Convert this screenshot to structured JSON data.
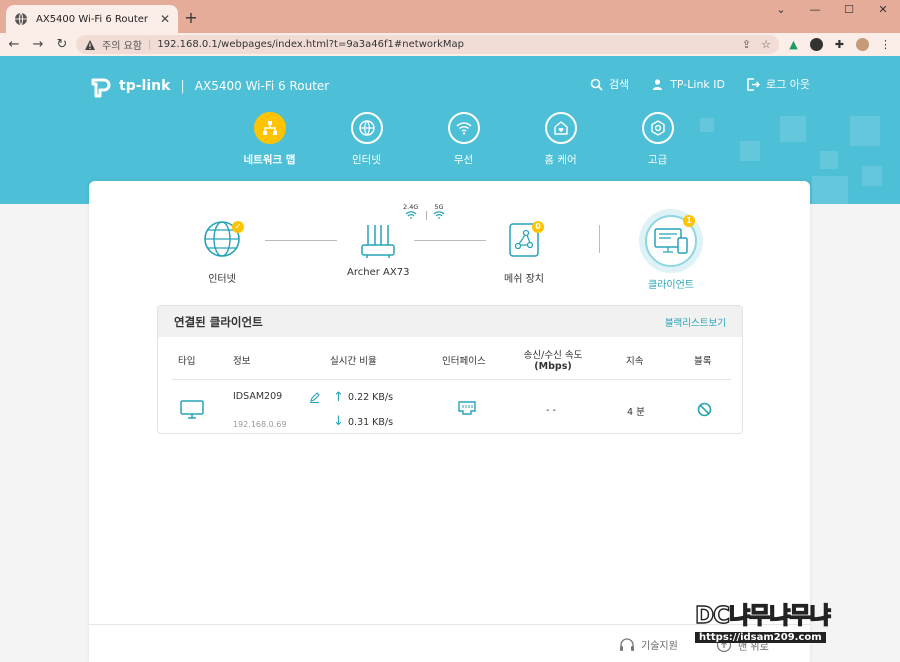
{
  "browser": {
    "tab_title": "AX5400 Wi-Fi 6 Router",
    "security_label": "주의 요함",
    "url": "192.168.0.1/webpages/index.html?t=9a3a46f1#networkMap"
  },
  "header": {
    "logo_text": "tp-link",
    "model": "AX5400 Wi-Fi 6 Router",
    "links": {
      "search": "검색",
      "tplink_id": "TP-Link ID",
      "logout": "로그 아웃"
    }
  },
  "nav": {
    "items": [
      {
        "label": "네트워크 맵",
        "icon": "network-map-icon",
        "active": true
      },
      {
        "label": "인터넷",
        "icon": "globe-icon",
        "active": false
      },
      {
        "label": "무선",
        "icon": "wifi-icon",
        "active": false
      },
      {
        "label": "홈 케어",
        "icon": "home-care-icon",
        "active": false
      },
      {
        "label": "고급",
        "icon": "gear-icon",
        "active": false
      }
    ]
  },
  "topology": {
    "internet_label": "인터넷",
    "router_label": "Archer AX73",
    "band_24": "2.4G",
    "band_5": "5G",
    "mesh_label": "메쉬 장치",
    "mesh_badge": "0",
    "clients_label": "클라이언트",
    "clients_badge": "1"
  },
  "clients_panel": {
    "title": "연결된 클라이언트",
    "blacklist_link": "블랙리스트보기",
    "columns": {
      "type": "타입",
      "info": "정보",
      "realtime": "실시간 비율",
      "interface": "인터페이스",
      "speed_line1": "송신/수신 속도",
      "speed_line2": "(Mbps)",
      "duration": "지속",
      "block": "블록"
    },
    "rows": [
      {
        "name": "IDSAM209",
        "ip": "192.168.0.69",
        "upload": "0.22 KB/s",
        "download": "0.31 KB/s",
        "speed": "- -",
        "duration": "4 분"
      }
    ]
  },
  "footer": {
    "support": "기술지원",
    "top": "맨 위로"
  },
  "watermark": {
    "text": "DC냐무냐무냐",
    "url": "https://idsam209.com"
  },
  "colors": {
    "header_bg": "#4dbfd6",
    "accent": "#27a3b8",
    "active_nav": "#ffc400",
    "tab_strip": "#e6ac9a"
  }
}
